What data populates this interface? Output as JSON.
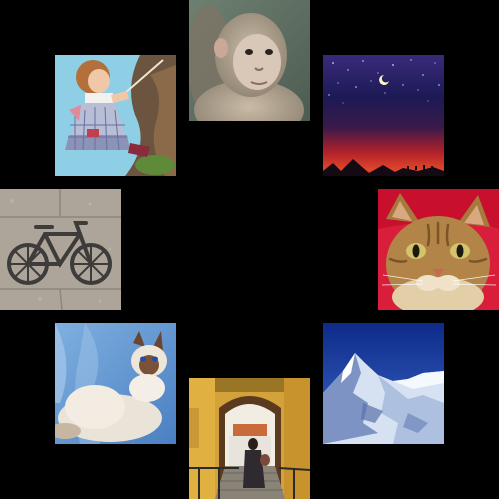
{
  "gallery": {
    "background": "#000000",
    "tiles": [
      {
        "id": "monkey",
        "icon": "monkey-photo"
      },
      {
        "id": "doll",
        "icon": "doll-photo"
      },
      {
        "id": "night",
        "icon": "night-sky-photo"
      },
      {
        "id": "bike",
        "icon": "bicycle-sign-photo"
      },
      {
        "id": "cat",
        "icon": "tabby-cat-photo"
      },
      {
        "id": "siamese",
        "icon": "white-cat-photo"
      },
      {
        "id": "mountain",
        "icon": "mountain-photo"
      },
      {
        "id": "alley",
        "icon": "alley-stairs-photo"
      }
    ]
  }
}
